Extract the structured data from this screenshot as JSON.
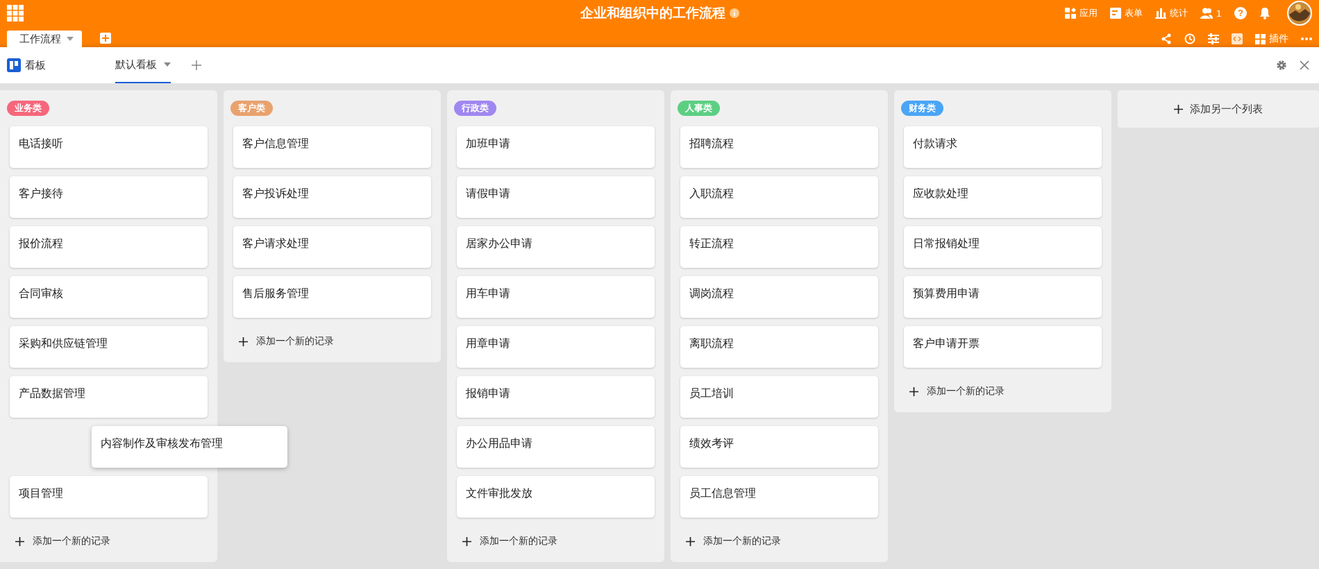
{
  "header": {
    "title": "企业和组织中的工作流程",
    "actions": [
      {
        "kind": "apps",
        "label": "应用"
      },
      {
        "kind": "form",
        "label": "表单"
      },
      {
        "kind": "stats",
        "label": "统计"
      },
      {
        "kind": "users",
        "label": "1"
      }
    ],
    "help": "?",
    "table_tab": {
      "label": "工作流程"
    },
    "tools": [
      {
        "kind": "share"
      },
      {
        "kind": "history"
      },
      {
        "kind": "sliders"
      },
      {
        "kind": "code"
      },
      {
        "kind": "plugins",
        "label": "插件"
      },
      {
        "kind": "more"
      }
    ]
  },
  "view_bar": {
    "view_type": "看板",
    "views": [
      {
        "label": "默认看板",
        "selected": true
      }
    ]
  },
  "columns": [
    {
      "tag": "业务类",
      "color": "#f5677c",
      "cards": [
        {
          "title": "电话接听",
          "dragging": false
        },
        {
          "title": "客户接待",
          "dragging": false
        },
        {
          "title": "报价流程",
          "dragging": false
        },
        {
          "title": "合同审核",
          "dragging": false
        },
        {
          "title": "采购和供应链管理",
          "dragging": false
        },
        {
          "title": "产品数据管理",
          "dragging": false
        },
        {
          "title": "内容制作及审核发布管理",
          "dragging": true
        },
        {
          "title": "项目管理",
          "dragging": false
        }
      ],
      "add_label": "添加一个新的记录"
    },
    {
      "tag": "客户类",
      "color": "#e9a26e",
      "cards": [
        {
          "title": "客户信息管理",
          "dragging": false
        },
        {
          "title": "客户投诉处理",
          "dragging": false
        },
        {
          "title": "客户请求处理",
          "dragging": false
        },
        {
          "title": "售后服务管理",
          "dragging": false
        }
      ],
      "add_label": "添加一个新的记录"
    },
    {
      "tag": "行政类",
      "color": "#9f87f0",
      "cards": [
        {
          "title": "加班申请",
          "dragging": false
        },
        {
          "title": "请假申请",
          "dragging": false
        },
        {
          "title": "居家办公申请",
          "dragging": false
        },
        {
          "title": "用车申请",
          "dragging": false
        },
        {
          "title": "用章申请",
          "dragging": false
        },
        {
          "title": "报销申请",
          "dragging": false
        },
        {
          "title": "办公用品申请",
          "dragging": false
        },
        {
          "title": "文件审批发放",
          "dragging": false
        }
      ],
      "add_label": "添加一个新的记录"
    },
    {
      "tag": "人事类",
      "color": "#5ccf82",
      "cards": [
        {
          "title": "招聘流程",
          "dragging": false
        },
        {
          "title": "入职流程",
          "dragging": false
        },
        {
          "title": "转正流程",
          "dragging": false
        },
        {
          "title": "调岗流程",
          "dragging": false
        },
        {
          "title": "离职流程",
          "dragging": false
        },
        {
          "title": "员工培训",
          "dragging": false
        },
        {
          "title": "绩效考评",
          "dragging": false
        },
        {
          "title": "员工信息管理",
          "dragging": false
        }
      ],
      "add_label": "添加一个新的记录"
    },
    {
      "tag": "财务类",
      "color": "#4aa5f6",
      "cards": [
        {
          "title": "付款请求",
          "dragging": false
        },
        {
          "title": "应收款处理",
          "dragging": false
        },
        {
          "title": "日常报销处理",
          "dragging": false
        },
        {
          "title": "预算费用申请",
          "dragging": false
        },
        {
          "title": "客户申请开票",
          "dragging": false
        }
      ],
      "add_label": "添加一个新的记录"
    }
  ],
  "add_list": {
    "label": "添加另一个列表"
  }
}
